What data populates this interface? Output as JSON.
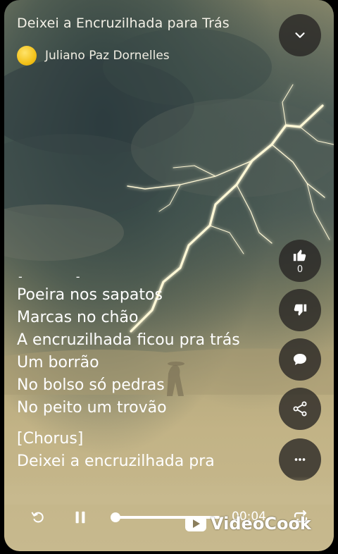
{
  "song": {
    "title": "Deixei a Encruzilhada para Trás",
    "artist": "Juliano Paz Dornelles"
  },
  "actions": {
    "collapse_icon": "chevron-down-icon",
    "like_icon": "thumbs-up-icon",
    "like_count": "0",
    "dislike_icon": "thumbs-down-icon",
    "comment_icon": "comment-icon",
    "share_icon": "share-icon",
    "more_icon": "more-icon"
  },
  "lyrics": {
    "marker_left": "-",
    "marker_right": "-",
    "verse": [
      "Poeira nos sapatos",
      "Marcas no chão",
      "A encruzilhada ficou pra trás",
      "Um borrão",
      "No bolso só pedras",
      "No peito um trovão"
    ],
    "chorus_tag": "[Chorus]",
    "chorus_first": "Deixei a encruzilhada pra"
  },
  "player": {
    "current_time": "00:04",
    "progress": 0.0,
    "state": "playing",
    "replay_icon": "replay-icon",
    "pause_icon": "pause-icon",
    "repeat_icon": "repeat-icon"
  },
  "watermark": {
    "text": "VideoCook"
  },
  "colors": {
    "button_bg": "#26241f",
    "text": "#ffffff",
    "avatar": "#f3c21a"
  }
}
